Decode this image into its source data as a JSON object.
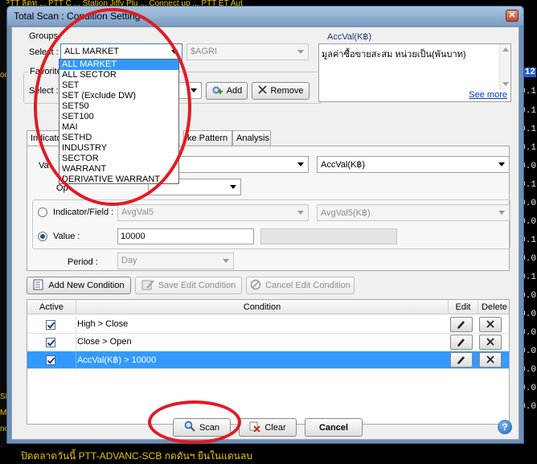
{
  "background": {
    "top_ticker": "] PTT ลีดท ... PTT C ... Station Jiffy Plu ... Connect up ... PTT ET Aut",
    "bottom_ticker": "ปิดตลาดวันนี้ PTT-ADVANC-SCB กดดันฯ ยืนในแดนลบ",
    "left_chars": [
      "oc",
      "SL",
      "Mi",
      "nc"
    ],
    "right_values": [
      "12",
      "0.1",
      "0.1",
      "0.1",
      "0.1",
      "0.0",
      "0.1",
      "0.0",
      "0.0",
      "0.1",
      "0.0",
      "0.1",
      "0.0",
      "0.0",
      "0.0",
      "0.0",
      "0.0",
      "0.0",
      "0.0"
    ]
  },
  "window": {
    "title": "Total Scan : Condition Setting",
    "close_glyph": "✕"
  },
  "groups": {
    "title": "Groups",
    "select_label": "Select :",
    "selected": "ALL MARKET",
    "secondary_value": "$AGRI",
    "options": [
      "ALL MARKET",
      "ALL SECTOR",
      "SET",
      "SET (Exclude DW)",
      "SET50",
      "SET100",
      "MAI",
      "SETHD",
      "INDUSTRY",
      "SECTOR",
      "WARRANT",
      "DERIVATIVE WARRANT"
    ]
  },
  "favorites": {
    "title": "Favorites",
    "select_label": "Select :",
    "add_label": "Add",
    "remove_label": "Remove"
  },
  "description": {
    "title": "AccVal(K฿)",
    "text": "มูลค่าซื้อขายสะสม หน่วยเป็น(พันบาท)",
    "see_more": "See more"
  },
  "tabs": [
    "Indicator",
    "ke Pattern",
    "Analysis"
  ],
  "condition_form": {
    "value_label": "Va",
    "value_combo": "AccVal(K฿)",
    "operator_label": "Op",
    "indicator_label": "Indicator/Field :",
    "indicator_field": "AvgVal5",
    "indicator_combo": "AvgVal5(K฿)",
    "value_radio_label": "Value :",
    "value_input": "10000",
    "period_label": "Period :",
    "period_value": "Day"
  },
  "actions": {
    "add_condition": "Add New Condition",
    "save_condition": "Save Edit Condition",
    "cancel_condition": "Cancel Edit Condition"
  },
  "grid": {
    "headers": {
      "active": "Active",
      "condition": "Condition",
      "edit": "Edit",
      "delete": "Delete"
    },
    "rows": [
      {
        "active": true,
        "condition": "High > Close"
      },
      {
        "active": true,
        "condition": "Close > Open"
      },
      {
        "active": true,
        "condition": "AccVal(K฿) > 10000"
      }
    ]
  },
  "footer": {
    "scan_label": "Scan",
    "clear_label": "Clear",
    "cancel_label": "Cancel",
    "help_glyph": "?"
  }
}
